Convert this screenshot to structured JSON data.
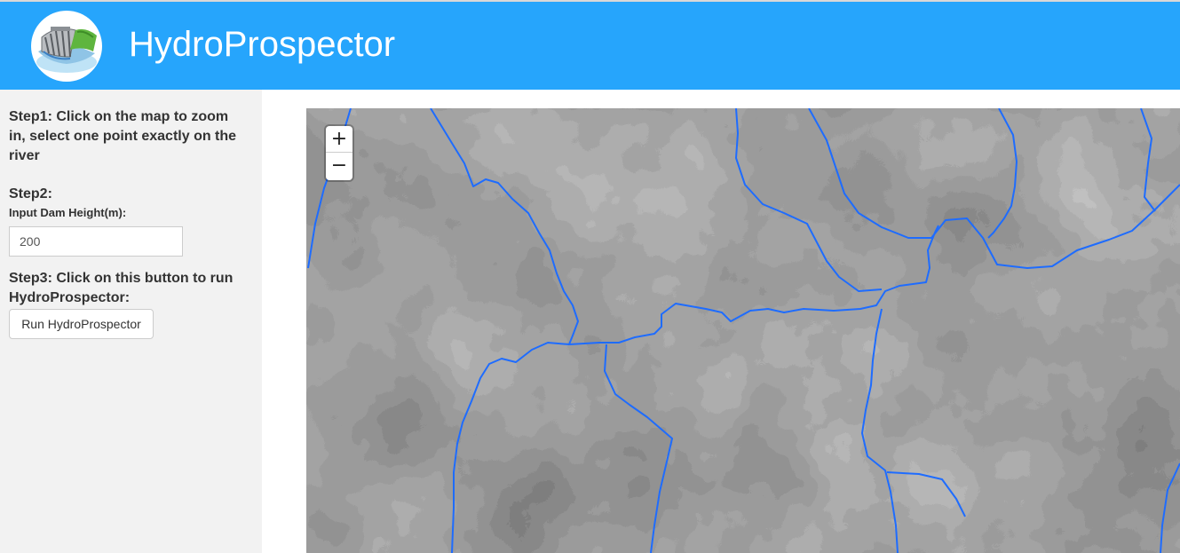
{
  "header": {
    "title": "HydroProspector",
    "background_color": "#26a5fc",
    "logo_icon": "dam-icon"
  },
  "sidebar": {
    "step1": "Step1: Click on the map to zoom in, select one point exactly on the river",
    "step2": "Step2:",
    "dam_height_label": "Input Dam Height(m):",
    "dam_height_value": "200",
    "step3": "Step3: Click on this button to run HydroProspector:",
    "run_button_label": "Run HydroProspector"
  },
  "map": {
    "zoom_in_label": "+",
    "zoom_out_label": "−",
    "river_color": "#1e6cff",
    "terrain": "grayscale elevation"
  }
}
